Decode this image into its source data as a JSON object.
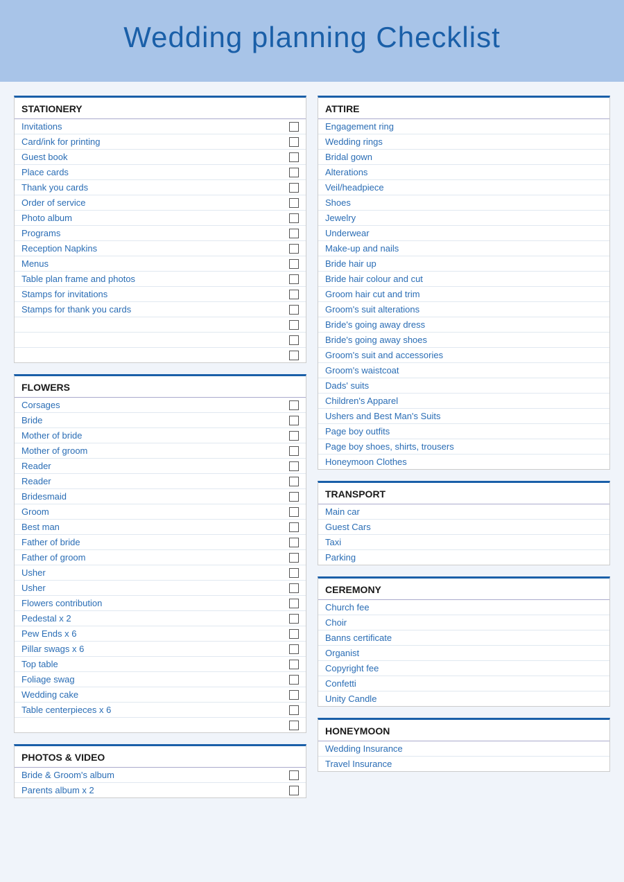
{
  "header": {
    "title": "Wedding planning Checklist"
  },
  "sections": [
    {
      "id": "stationery",
      "title": "STATIONERY",
      "column": "left",
      "items": [
        {
          "label": "Invitations",
          "checkbox": true
        },
        {
          "label": "Card/ink for printing",
          "checkbox": true
        },
        {
          "label": "Guest book",
          "checkbox": true
        },
        {
          "label": "Place cards",
          "checkbox": true
        },
        {
          "label": "Thank you cards",
          "checkbox": true
        },
        {
          "label": "Order of service",
          "checkbox": true
        },
        {
          "label": "Photo album",
          "checkbox": true
        },
        {
          "label": "Programs",
          "checkbox": true
        },
        {
          "label": "Reception Napkins",
          "checkbox": true
        },
        {
          "label": "Menus",
          "checkbox": true
        },
        {
          "label": "Table plan frame and photos",
          "checkbox": true
        },
        {
          "label": "Stamps for invitations",
          "checkbox": true
        },
        {
          "label": "Stamps for thank you cards",
          "checkbox": true
        },
        {
          "label": "",
          "checkbox": true
        },
        {
          "label": "",
          "checkbox": true
        },
        {
          "label": "",
          "checkbox": true
        }
      ]
    },
    {
      "id": "flowers",
      "title": "FLOWERS",
      "column": "left",
      "items": [
        {
          "label": "Corsages",
          "checkbox": true
        },
        {
          "label": "Bride",
          "checkbox": true
        },
        {
          "label": "Mother of bride",
          "checkbox": true
        },
        {
          "label": "Mother of groom",
          "checkbox": true
        },
        {
          "label": "Reader",
          "checkbox": true
        },
        {
          "label": "Reader",
          "checkbox": true
        },
        {
          "label": "Bridesmaid",
          "checkbox": true
        },
        {
          "label": "Groom",
          "checkbox": true
        },
        {
          "label": "Best man",
          "checkbox": true
        },
        {
          "label": "Father of bride",
          "checkbox": true
        },
        {
          "label": "Father of groom",
          "checkbox": true
        },
        {
          "label": "Usher",
          "checkbox": true
        },
        {
          "label": "Usher",
          "checkbox": true
        },
        {
          "label": "Flowers contribution",
          "checkbox": true
        },
        {
          "label": "Pedestal x 2",
          "checkbox": true
        },
        {
          "label": "Pew Ends x 6",
          "checkbox": true
        },
        {
          "label": "Pillar swags x 6",
          "checkbox": true
        },
        {
          "label": "Top table",
          "checkbox": true
        },
        {
          "label": "Foliage swag",
          "checkbox": true
        },
        {
          "label": "Wedding cake",
          "checkbox": true
        },
        {
          "label": "Table centerpieces x 6",
          "checkbox": true
        },
        {
          "label": "",
          "checkbox": true
        }
      ]
    },
    {
      "id": "photos-video",
      "title": "PHOTOS & VIDEO",
      "column": "left",
      "items": [
        {
          "label": "Bride & Groom's album",
          "checkbox": true
        },
        {
          "label": "Parents album x 2",
          "checkbox": true
        }
      ]
    },
    {
      "id": "attire",
      "title": "ATTIRE",
      "column": "right",
      "items": [
        {
          "label": "Engagement ring",
          "checkbox": false
        },
        {
          "label": "Wedding rings",
          "checkbox": false
        },
        {
          "label": "Bridal gown",
          "checkbox": false
        },
        {
          "label": "Alterations",
          "checkbox": false
        },
        {
          "label": "Veil/headpiece",
          "checkbox": false
        },
        {
          "label": "Shoes",
          "checkbox": false
        },
        {
          "label": "Jewelry",
          "checkbox": false
        },
        {
          "label": "Underwear",
          "checkbox": false
        },
        {
          "label": "Make-up and nails",
          "checkbox": false
        },
        {
          "label": "Bride hair up",
          "checkbox": false
        },
        {
          "label": "Bride hair colour and cut",
          "checkbox": false
        },
        {
          "label": "Groom hair cut and trim",
          "checkbox": false
        },
        {
          "label": "Groom's suit alterations",
          "checkbox": false
        },
        {
          "label": "Bride's going away dress",
          "checkbox": false
        },
        {
          "label": "Bride's going away shoes",
          "checkbox": false
        },
        {
          "label": "Groom's suit and accessories",
          "checkbox": false
        },
        {
          "label": "Groom's waistcoat",
          "checkbox": false
        },
        {
          "label": "Dads' suits",
          "checkbox": false
        },
        {
          "label": "Children's Apparel",
          "checkbox": false
        },
        {
          "label": "Ushers and Best Man's Suits",
          "checkbox": false
        },
        {
          "label": "Page boy outfits",
          "checkbox": false
        },
        {
          "label": "Page boy shoes, shirts, trousers",
          "checkbox": false
        },
        {
          "label": "Honeymoon Clothes",
          "checkbox": false
        }
      ]
    },
    {
      "id": "transport",
      "title": "TRANSPORT",
      "column": "right",
      "items": [
        {
          "label": "Main car",
          "checkbox": false
        },
        {
          "label": "Guest Cars",
          "checkbox": false
        },
        {
          "label": "Taxi",
          "checkbox": false
        },
        {
          "label": "Parking",
          "checkbox": false
        }
      ]
    },
    {
      "id": "ceremony",
      "title": "CEREMONY",
      "column": "right",
      "items": [
        {
          "label": "Church fee",
          "checkbox": false
        },
        {
          "label": "Choir",
          "checkbox": false
        },
        {
          "label": "Banns certificate",
          "checkbox": false
        },
        {
          "label": "Organist",
          "checkbox": false
        },
        {
          "label": "Copyright fee",
          "checkbox": false
        },
        {
          "label": "Confetti",
          "checkbox": false
        },
        {
          "label": "Unity Candle",
          "checkbox": false
        }
      ]
    },
    {
      "id": "honeymoon",
      "title": "HONEYMOON",
      "column": "right",
      "items": [
        {
          "label": "Wedding Insurance",
          "checkbox": false
        },
        {
          "label": "Travel Insurance",
          "checkbox": false
        }
      ]
    }
  ]
}
